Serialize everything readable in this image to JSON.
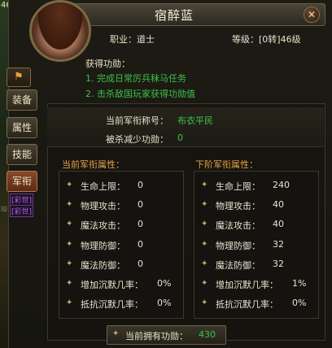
{
  "hud": {
    "level": "46"
  },
  "window": {
    "title": "宿醉蓝",
    "close": "✕"
  },
  "character": {
    "profession": "职业：道士",
    "level_text": "等级：[0转]46级"
  },
  "mission": {
    "title": "获得功勋：",
    "items": [
      "1. 完成日常厉兵秣马任务",
      "2. 击杀敌国玩家获得功勋值"
    ]
  },
  "rank": {
    "label": "当前军衔称号：",
    "value": "布衣平民",
    "reduce_label": "被杀减少功勋：",
    "reduce_value": "0"
  },
  "tabs": [
    {
      "label": "装备"
    },
    {
      "label": "属性"
    },
    {
      "label": "技能"
    },
    {
      "label": "军衔"
    }
  ],
  "side_tags": [
    "[彩世]",
    "[彩世]"
  ],
  "current": {
    "title": "当前军衔属性：",
    "stats": [
      {
        "name": "生命上限：",
        "value": "0"
      },
      {
        "name": "物理攻击：",
        "value": "0"
      },
      {
        "name": "魔法攻击：",
        "value": "0"
      },
      {
        "name": "物理防御：",
        "value": "0"
      },
      {
        "name": "魔法防御：",
        "value": "0"
      },
      {
        "name": "增加沉默几率：",
        "value": "0%"
      },
      {
        "name": "抵抗沉默几率：",
        "value": "0%"
      }
    ]
  },
  "next": {
    "title": "下阶军衔属性：",
    "stats": [
      {
        "name": "生命上限：",
        "value": "240"
      },
      {
        "name": "物理攻击：",
        "value": "40"
      },
      {
        "name": "魔法攻击：",
        "value": "40"
      },
      {
        "name": "物理防御：",
        "value": "32"
      },
      {
        "name": "魔法防御：",
        "value": "32"
      },
      {
        "name": "增加沉默几率：",
        "value": "1%"
      },
      {
        "name": "抵抗沉默几率：",
        "value": "0%"
      }
    ]
  },
  "footer": {
    "label": "当前拥有功勋：",
    "value": "430"
  },
  "colors": {
    "accent": "#3ec24a",
    "section_title": "#e9a24a",
    "text": "#e8e2cc"
  }
}
